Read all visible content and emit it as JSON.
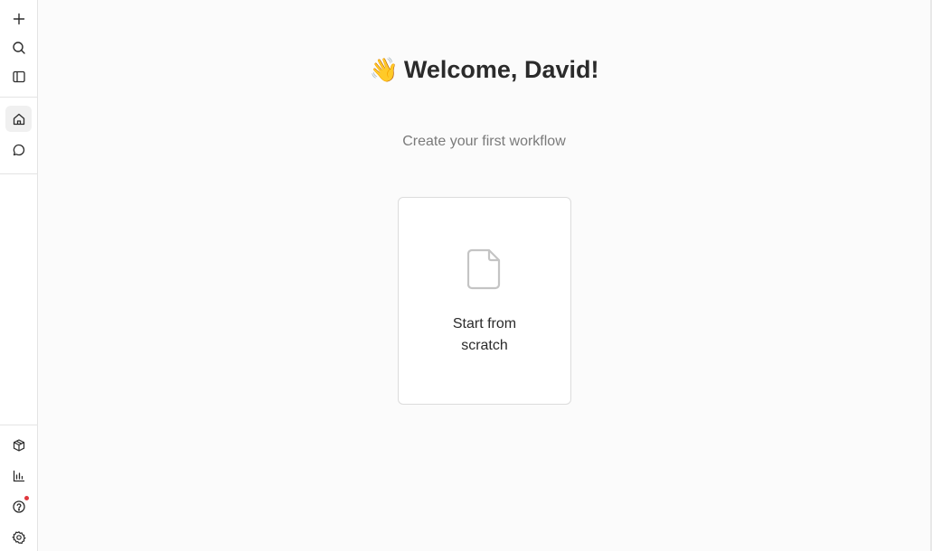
{
  "sidebar": {
    "top_items": [
      {
        "icon": "plus-icon"
      },
      {
        "icon": "search-icon"
      },
      {
        "icon": "sidebar-toggle-icon"
      }
    ],
    "nav_items": [
      {
        "icon": "home-icon",
        "active": true
      },
      {
        "icon": "chat-icon",
        "active": false
      }
    ],
    "bottom_items": [
      {
        "icon": "package-icon"
      },
      {
        "icon": "chart-icon"
      },
      {
        "icon": "help-icon",
        "notification": true
      },
      {
        "icon": "gear-icon"
      }
    ]
  },
  "main": {
    "welcome_emoji": "👋",
    "welcome_text": "Welcome, David!",
    "subtitle": "Create your first workflow",
    "cards": [
      {
        "icon": "file-icon",
        "label_line1": "Start from",
        "label_line2": "scratch"
      }
    ]
  },
  "colors": {
    "notification_dot": "#e0383e",
    "border": "#e4e4e4",
    "subtitle": "#7a7a7a"
  }
}
